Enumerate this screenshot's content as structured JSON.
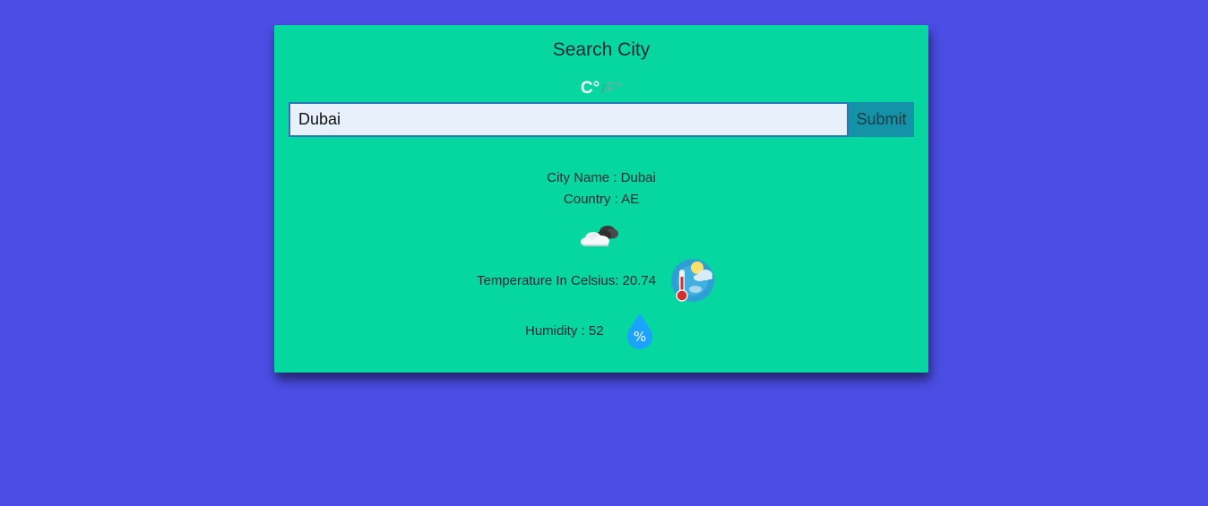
{
  "card": {
    "title": "Search City",
    "units": {
      "celsius": "C°",
      "separator": "/",
      "fahrenheit": "F°"
    },
    "search": {
      "value": "Dubai",
      "submit_label": "Submit"
    },
    "result": {
      "city_line": "City Name : Dubai",
      "country_line": "Country : AE",
      "weather_icon": "broken-clouds-icon",
      "temperature_line": "Temperature In Celsius: 20.74",
      "temperature_icon": "thermometer-weather-icon",
      "humidity_line": "Humidity : 52",
      "humidity_icon": "humidity-drop-icon",
      "humidity_icon_text": "%"
    }
  },
  "colors": {
    "background": "#4b4de5",
    "card": "#06d6a0",
    "submit": "#1492a8",
    "input_border": "#2778b8"
  }
}
